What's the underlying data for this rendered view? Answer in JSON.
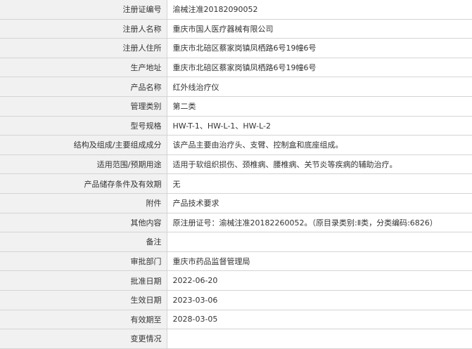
{
  "rows": [
    {
      "label": "注册证编号",
      "value": "渝械注准20182090052"
    },
    {
      "label": "注册人名称",
      "value": "重庆市国人医疗器械有限公司"
    },
    {
      "label": "注册人住所",
      "value": "重庆市北碚区蔡家岗镇凤栖路6号19幢6号"
    },
    {
      "label": "生产地址",
      "value": "重庆市北碚区蔡家岗镇凤栖路6号19幢6号"
    },
    {
      "label": "产品名称",
      "value": "红外线治疗仪"
    },
    {
      "label": "管理类别",
      "value": "第二类"
    },
    {
      "label": "型号规格",
      "value": "HW-T-1、HW-L-1、HW-L-2"
    },
    {
      "label": "结构及组成/主要组成成分",
      "value": "该产品主要由治疗头、支臂、控制盒和底座组成。"
    },
    {
      "label": "适用范围/预期用途",
      "value": "适用于软组织损伤、颈椎病、腰椎病、关节炎等疾病的辅助治疗。"
    },
    {
      "label": "产品储存条件及有效期",
      "value": "无"
    },
    {
      "label": "附件",
      "value": "产品技术要求"
    },
    {
      "label": "其他内容",
      "value": "原注册证号：渝械注准20182260052。（原目录类别:Ⅱ类，分类编码:6826）"
    },
    {
      "label": "备注",
      "value": ""
    },
    {
      "label": "审批部门",
      "value": "重庆市药品监督管理局"
    },
    {
      "label": "批准日期",
      "value": "2022-06-20"
    },
    {
      "label": "生效日期",
      "value": "2023-03-06"
    },
    {
      "label": "有效期至",
      "value": "2028-03-05"
    },
    {
      "label": "变更情况",
      "value": ""
    }
  ]
}
